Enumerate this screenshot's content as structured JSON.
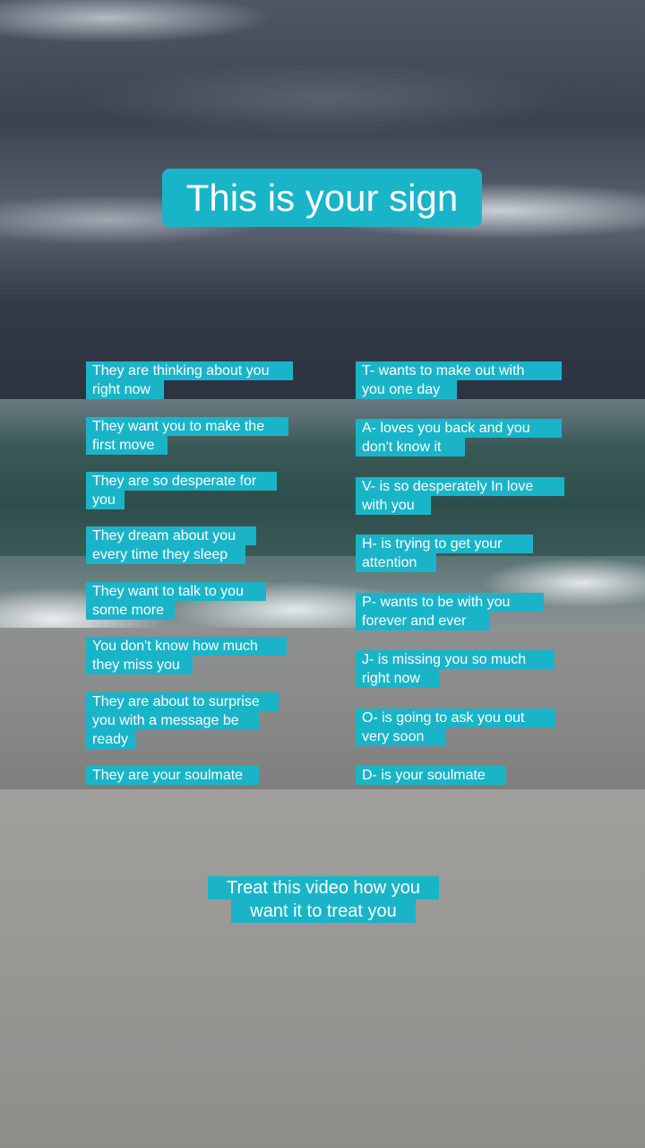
{
  "title": "This is your sign",
  "left_captions": [
    {
      "line1": "They are thinking about you",
      "line2": "right now"
    },
    {
      "line1": "They want you to make the",
      "line2": "first move"
    },
    {
      "line1": "They are so desperate for",
      "line2": "you"
    },
    {
      "line1": "They dream about you",
      "line2": "every time they sleep"
    },
    {
      "line1": "They want to talk to you",
      "line2": "some more"
    },
    {
      "line1": "You don't know how much",
      "line2": "they miss you"
    },
    {
      "line1": "They are about to surprise",
      "line2": "you with a message be",
      "line3": "ready"
    },
    {
      "line1": "They are your soulmate"
    }
  ],
  "right_captions": [
    {
      "line1": "T- wants to make out with",
      "line2": "you one day"
    },
    {
      "line1": "A- loves you back and you",
      "line2": "don't know it"
    },
    {
      "line1": "V- is so desperately In love",
      "line2": "with you"
    },
    {
      "line1": "H- is trying to get your",
      "line2": "attention"
    },
    {
      "line1": "P- wants to be with you",
      "line2": "forever and ever"
    },
    {
      "line1": "J- is missing you so much",
      "line2": "right now"
    },
    {
      "line1": "O- is going to ask you out",
      "line2": "very soon"
    },
    {
      "line1": "D- is your soulmate"
    }
  ],
  "footer": {
    "line1": "Treat this video how you",
    "line2": "want it to treat you"
  },
  "colors": {
    "caption_bg": "#1ab4c9",
    "caption_text": "#ffffff"
  }
}
